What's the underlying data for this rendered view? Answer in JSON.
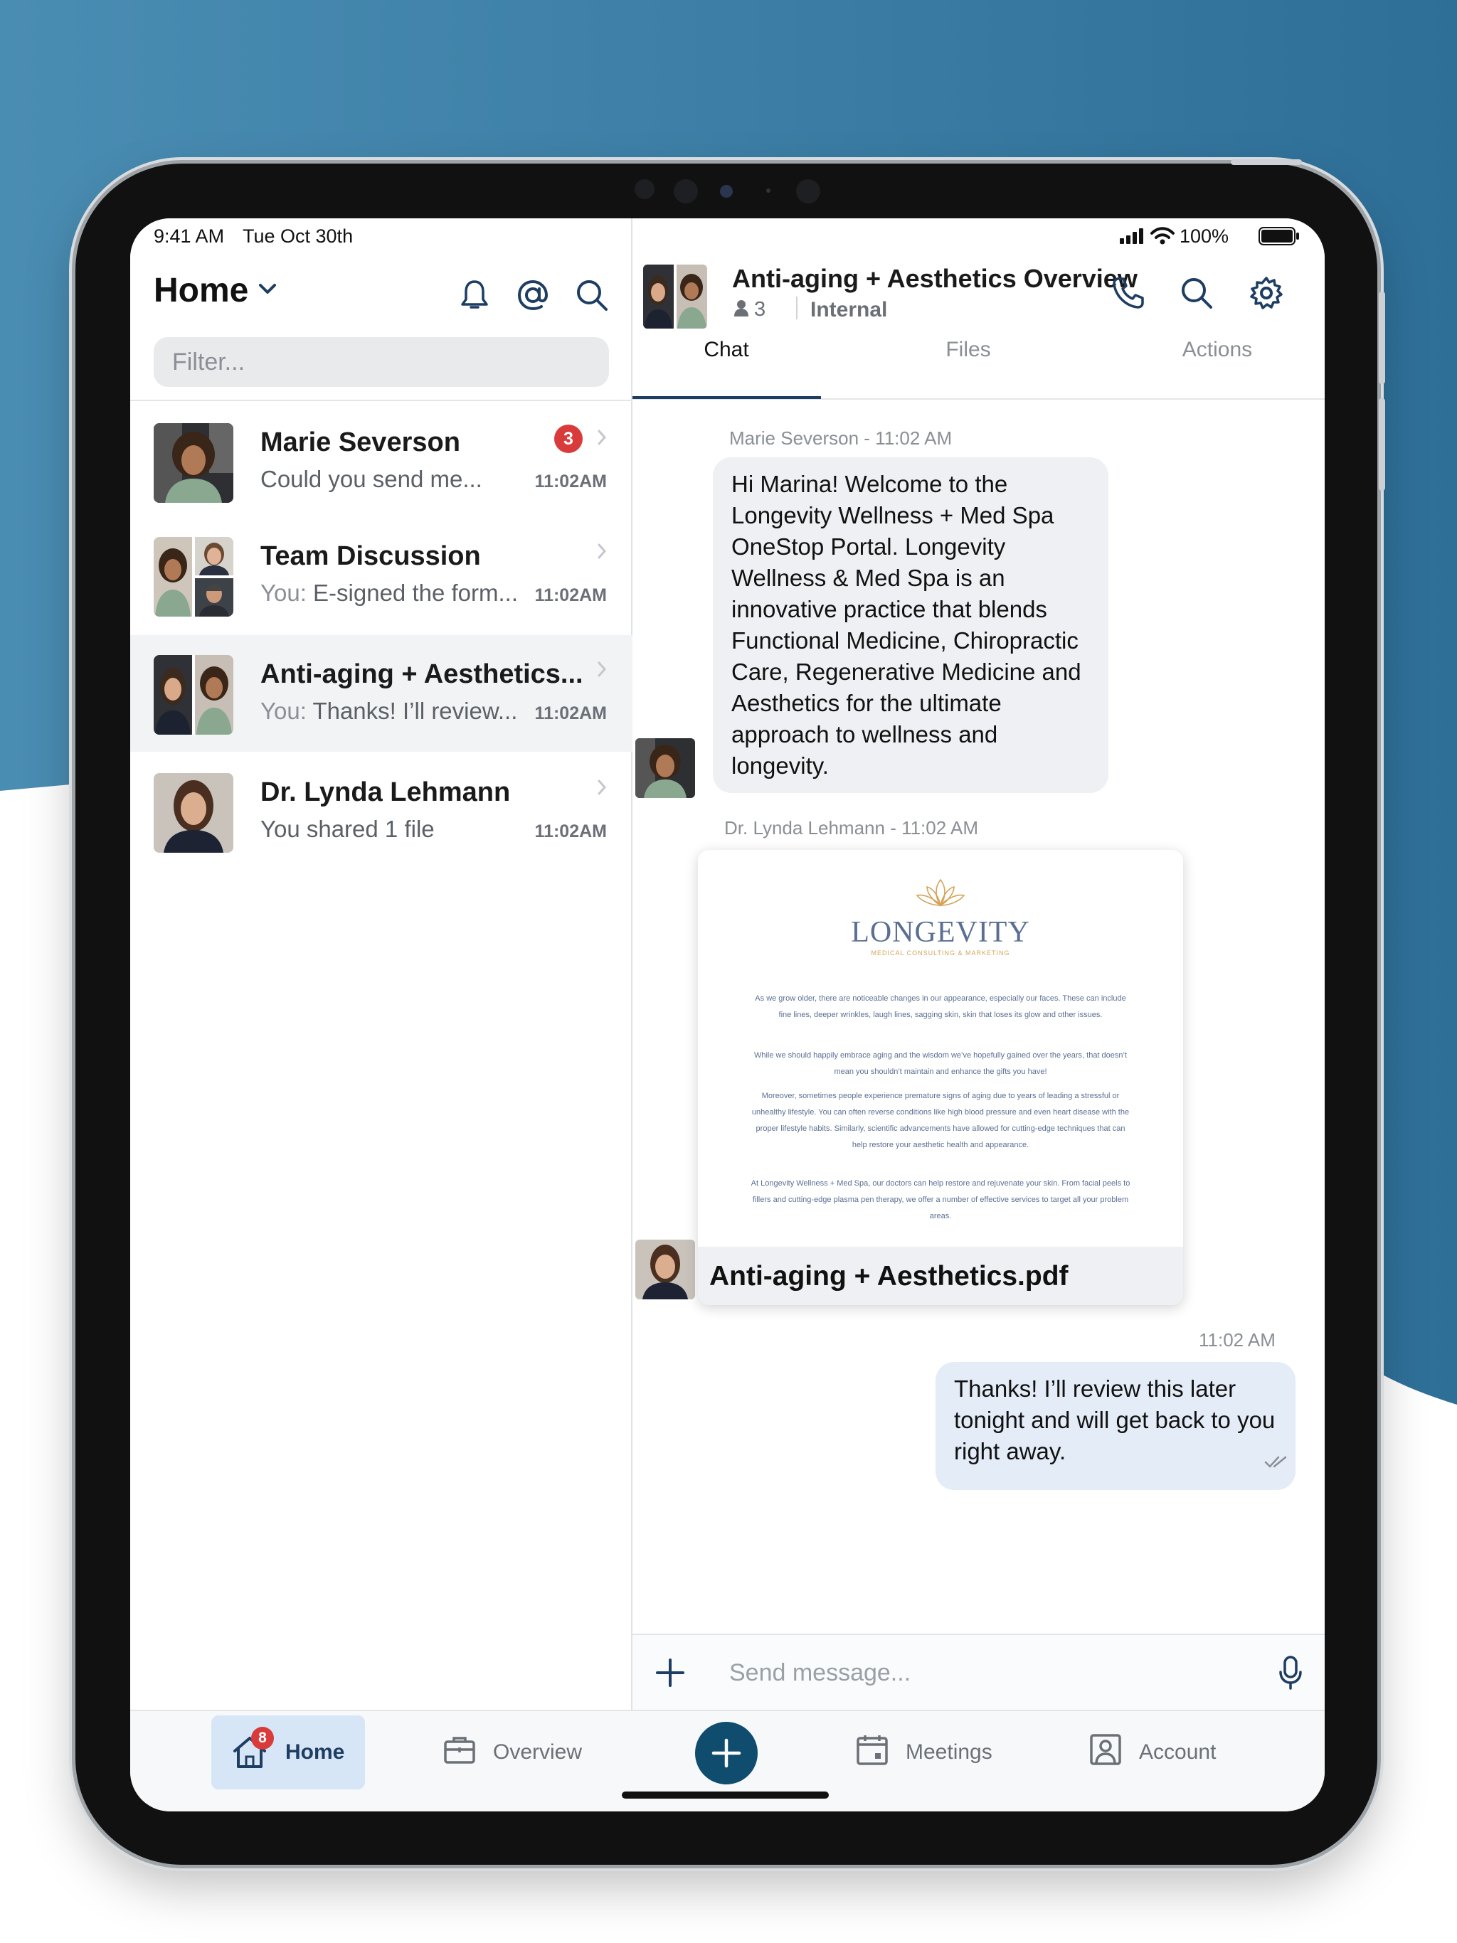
{
  "status_bar": {
    "time": "9:41 AM",
    "date": "Tue Oct 30th",
    "battery": "100%"
  },
  "sidebar": {
    "title": "Home",
    "filter_placeholder": "Filter...",
    "conversations": [
      {
        "name": "Marie Severson",
        "preview": "Could you send me...",
        "time": "11:02AM",
        "unread": "3"
      },
      {
        "name": "Team Discussion",
        "prefix": "You:",
        "preview": "E-signed the form...",
        "time": "11:02AM"
      },
      {
        "name": "Anti-aging + Aesthetics...",
        "prefix": "You:",
        "preview": "Thanks! I’ll review...",
        "time": "11:02AM"
      },
      {
        "name": "Dr. Lynda Lehmann",
        "preview": "You shared 1 file",
        "time": "11:02AM"
      }
    ]
  },
  "chat": {
    "title": "Anti-aging + Aesthetics Overview",
    "member_count": "3",
    "visibility": "Internal",
    "tabs": [
      "Chat",
      "Files",
      "Actions"
    ],
    "messages": [
      {
        "meta": "Marie Severson - 11:02 AM",
        "text": "Hi Marina! Welcome to the Longevity Wellness + Med Spa OneStop Portal. Longevity Wellness & Med Spa is an innovative practice that blends Functional Medicine, Chiropractic Care, Regenerative Medicine and Aesthetics for the ultimate approach to wellness and longevity."
      },
      {
        "meta": "Dr. Lynda Lehmann - 11:02 AM",
        "file_name": "Anti-aging + Aesthetics.pdf"
      },
      {
        "meta": "11:02 AM",
        "text": "Thanks! I’ll review this later tonight and will get back to you right away."
      }
    ],
    "composer_placeholder": "Send message..."
  },
  "document_preview": {
    "logo": "LONGEVITY",
    "tagline": "MEDICAL CONSULTING & MARKETING",
    "paragraphs": [
      "As we grow older, there are noticeable changes in our appearance, especially our faces. These can include fine lines, deeper wrinkles, laugh lines, sagging skin, skin that loses its glow and other issues.",
      "While we should happily embrace aging and the wisdom we’ve hopefully gained over the years, that doesn’t mean you shouldn’t maintain and enhance the gifts you have!",
      "Moreover, sometimes people experience premature signs of aging due to years of leading a stressful or unhealthy lifestyle. You can often reverse conditions like high blood pressure and even heart disease with the proper lifestyle habits. Similarly, scientific advancements have allowed for cutting-edge techniques that can help restore your aesthetic health and appearance.",
      "At Longevity Wellness + Med Spa, our doctors can help restore and rejuvenate your skin. From facial peels to fillers and cutting-edge plasma pen therapy, we offer a number of effective services to target all your problem areas."
    ]
  },
  "tab_bar": {
    "items": [
      {
        "label": "Home",
        "badge": "8"
      },
      {
        "label": "Overview"
      },
      {
        "label": "Meetings"
      },
      {
        "label": "Account"
      }
    ]
  },
  "colors": {
    "brand": "#0f4c6d",
    "accent": "#1d3d63",
    "badge": "#d93b3b",
    "background_top": "#3b7ea6"
  }
}
